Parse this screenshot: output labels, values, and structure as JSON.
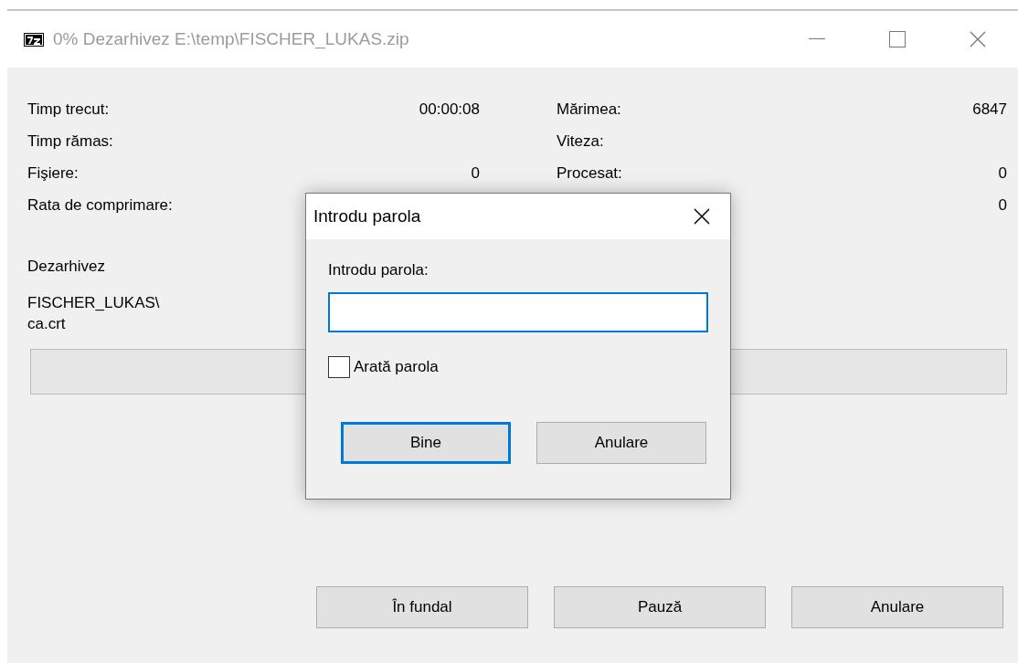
{
  "window": {
    "title": "0% Dezarhivez E:\\temp\\FISCHER_LUKAS.zip",
    "active": false
  },
  "stats_left": [
    {
      "label": "Timp trecut:",
      "value": "00:00:08"
    },
    {
      "label": "Timp rămas:"
    },
    {
      "label": "Fişiere:",
      "value": "0"
    },
    {
      "label": "Rata de comprimare:"
    }
  ],
  "stats_right": [
    {
      "label": "Mărimea:",
      "value": "6847"
    },
    {
      "label": "Viteza:"
    },
    {
      "label": "Procesat:",
      "value": "0"
    },
    {
      "value": "0"
    }
  ],
  "operation": "Dezarhivez",
  "current_file": [
    "FISCHER_LUKAS\\",
    "ca.crt"
  ],
  "progress": {
    "level": 0
  },
  "buttons": [
    "În fundal",
    "Pauză",
    "Anulare"
  ],
  "dialog": {
    "title": "Introdu parola",
    "label": "Introdu parola:",
    "field_focused": true,
    "checkbox": {
      "label": "Arată parola",
      "checked": false
    },
    "buttons": [
      {
        "label": "Bine",
        "default": true
      },
      {
        "label": "Anulare",
        "default": false
      }
    ]
  }
}
